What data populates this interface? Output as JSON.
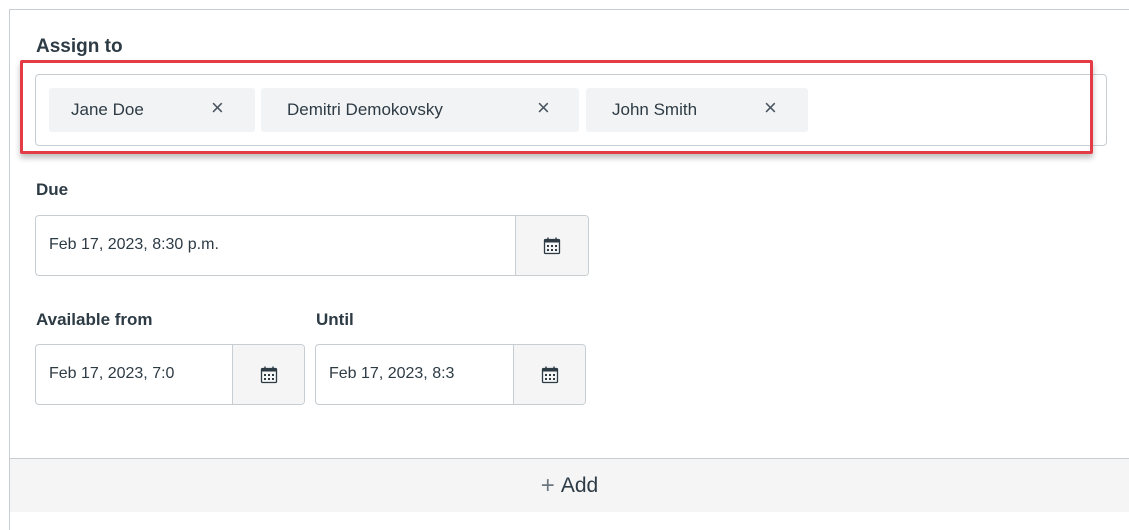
{
  "assign": {
    "label": "Assign to",
    "chips": [
      {
        "name": "Jane Doe",
        "remove": "×"
      },
      {
        "name": "Demitri Demokovsky",
        "remove": "×"
      },
      {
        "name": "John Smith",
        "remove": "×"
      }
    ]
  },
  "due": {
    "label": "Due",
    "value": "Feb 17, 2023, 8:30 p.m."
  },
  "available_from": {
    "label": "Available from",
    "value": "Feb 17, 2023, 7:0"
  },
  "until": {
    "label": "Until",
    "value": "Feb 17, 2023, 8:3"
  },
  "add_button": {
    "icon": "+",
    "label": "Add"
  },
  "icons": {
    "calendar": "calendar-icon",
    "remove": "close-icon"
  },
  "colors": {
    "highlight": "#e33c46",
    "text": "#2d3b45",
    "border": "#c7cdd1",
    "chip_bg": "#f2f3f4"
  }
}
